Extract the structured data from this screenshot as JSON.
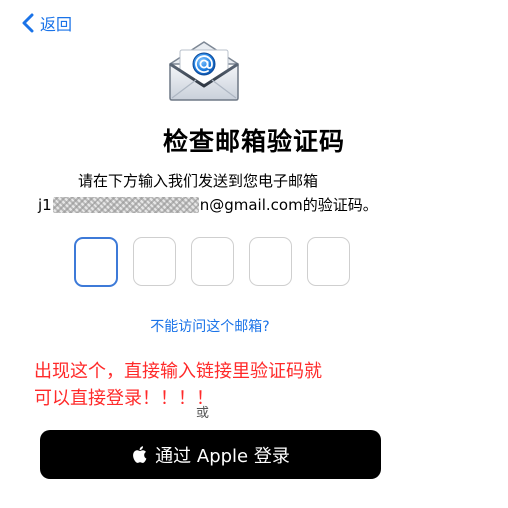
{
  "nav": {
    "back_label": "返回"
  },
  "header": {
    "title": "检查邮箱验证码"
  },
  "instruction": {
    "line1": "请在下方输入我们发送到您电子邮箱",
    "email_prefix": "j1",
    "email_suffix": "n@gmail.com",
    "line2_tail": " 的验证码。"
  },
  "code": {
    "box_count": 5,
    "active_index": 0
  },
  "links": {
    "cant_access": "不能访问这个邮箱?"
  },
  "annotation": {
    "line1": "出现这个，直接输入链接里验证码就",
    "line2": "可以直接登录！！！！"
  },
  "divider": {
    "or": "或"
  },
  "apple_button": {
    "label": "通过 Apple 登录"
  },
  "icons": {
    "back": "chevron-left-icon",
    "mail": "envelope-at-icon",
    "apple": "apple-logo-icon"
  },
  "colors": {
    "link": "#1a73e8",
    "active_box": "#3d7ad8",
    "annotation": "#ff2a2a",
    "button_bg": "#000000"
  }
}
